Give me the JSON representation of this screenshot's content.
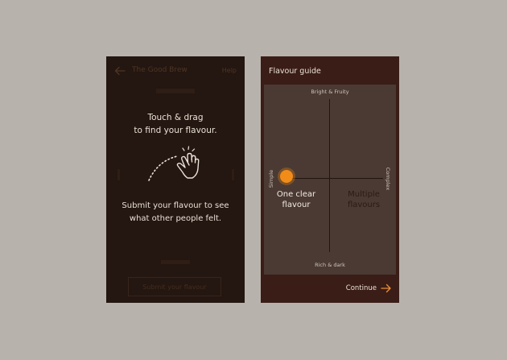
{
  "left_screen": {
    "app_title": "The Good Brew",
    "help_label": "Help",
    "submit_button_label": "Submit your flavour",
    "overlay": {
      "touch_line1": "Touch & drag",
      "touch_line2": "to find your flavour.",
      "submit_line1": "Submit your flavour to see",
      "submit_line2": "what other people felt."
    },
    "icons": [
      "back-arrow-icon",
      "hand-swipe-icon"
    ]
  },
  "right_screen": {
    "title": "Flavour guide",
    "axis_labels": {
      "top": "Bright & Fruity",
      "bottom": "Rich & dark",
      "left": "Simple",
      "right": "Complex"
    },
    "zones": {
      "simple_line1": "One clear",
      "simple_line2": "flavour",
      "complex_line1": "Multiple",
      "complex_line2": "flavours"
    },
    "continue_label": "Continue",
    "icons": [
      "arrow-right-icon"
    ]
  },
  "colors": {
    "page_background": "#b8b2ad",
    "left_screen_bg": "#2c1b15",
    "right_screen_bg": "#3a1d17",
    "guide_panel_bg": "#4a3a33",
    "accent_orange": "#f28c18",
    "text_light": "#ece2d6"
  }
}
